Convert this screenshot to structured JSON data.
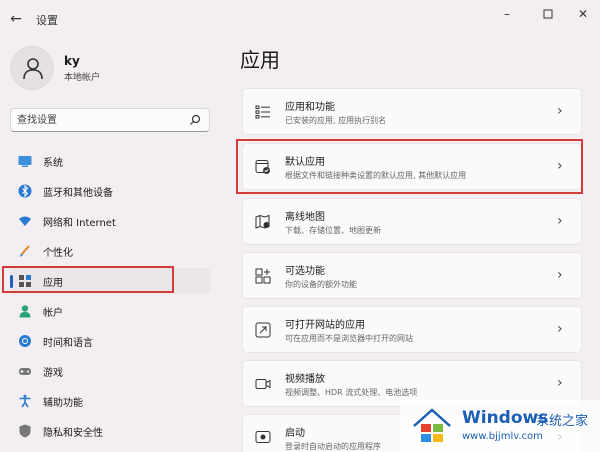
{
  "window": {
    "title": "设置",
    "back_icon": "arrow-left-icon",
    "controls": [
      "minimize-icon",
      "maximize-icon",
      "close-icon"
    ]
  },
  "profile": {
    "name": "ky",
    "type": "本地帐户",
    "avatar_icon": "person-icon"
  },
  "search": {
    "placeholder": "查找设置",
    "icon": "search-icon"
  },
  "nav": {
    "items": [
      {
        "label": "系统",
        "icon": "monitor-icon"
      },
      {
        "label": "蓝牙和其他设备",
        "icon": "bluetooth-icon"
      },
      {
        "label": "网络和 Internet",
        "icon": "wifi-icon"
      },
      {
        "label": "个性化",
        "icon": "brush-icon"
      },
      {
        "label": "应用",
        "icon": "apps-icon",
        "active": true
      },
      {
        "label": "帐户",
        "icon": "person-icon"
      },
      {
        "label": "时间和语言",
        "icon": "globe-clock-icon"
      },
      {
        "label": "游戏",
        "icon": "gamepad-icon"
      },
      {
        "label": "辅助功能",
        "icon": "accessibility-icon"
      },
      {
        "label": "隐私和安全性",
        "icon": "shield-icon"
      }
    ]
  },
  "main": {
    "title": "应用",
    "cards": [
      {
        "title": "应用和功能",
        "subtitle": "已安装的应用, 应用执行别名",
        "icon": "list-icon"
      },
      {
        "title": "默认应用",
        "subtitle": "根据文件和链接种类设置的默认应用, 其他默认应用",
        "icon": "default-apps-icon"
      },
      {
        "title": "离线地图",
        "subtitle": "下载、存储位置、地图更新",
        "icon": "map-icon"
      },
      {
        "title": "可选功能",
        "subtitle": "你的设备的额外功能",
        "icon": "optional-features-icon"
      },
      {
        "title": "可打开网站的应用",
        "subtitle": "可在应用而不是浏览器中打开的网站",
        "icon": "open-link-icon"
      },
      {
        "title": "视频播放",
        "subtitle": "视频调整、HDR 流式处理、电池选项",
        "icon": "video-icon"
      },
      {
        "title": "启动",
        "subtitle": "登录时自动启动的应用程序",
        "icon": "startup-icon"
      }
    ]
  },
  "watermark": {
    "brand": "Windows",
    "text": "系统之家",
    "url": "www.bjjmlv.com",
    "colors": {
      "brand": "#1a5fb4"
    }
  },
  "colors": {
    "background": "#f3eef2",
    "card": "#fbfafb",
    "accent": "#1f5fbf",
    "highlight_box": "#d33a3a"
  }
}
